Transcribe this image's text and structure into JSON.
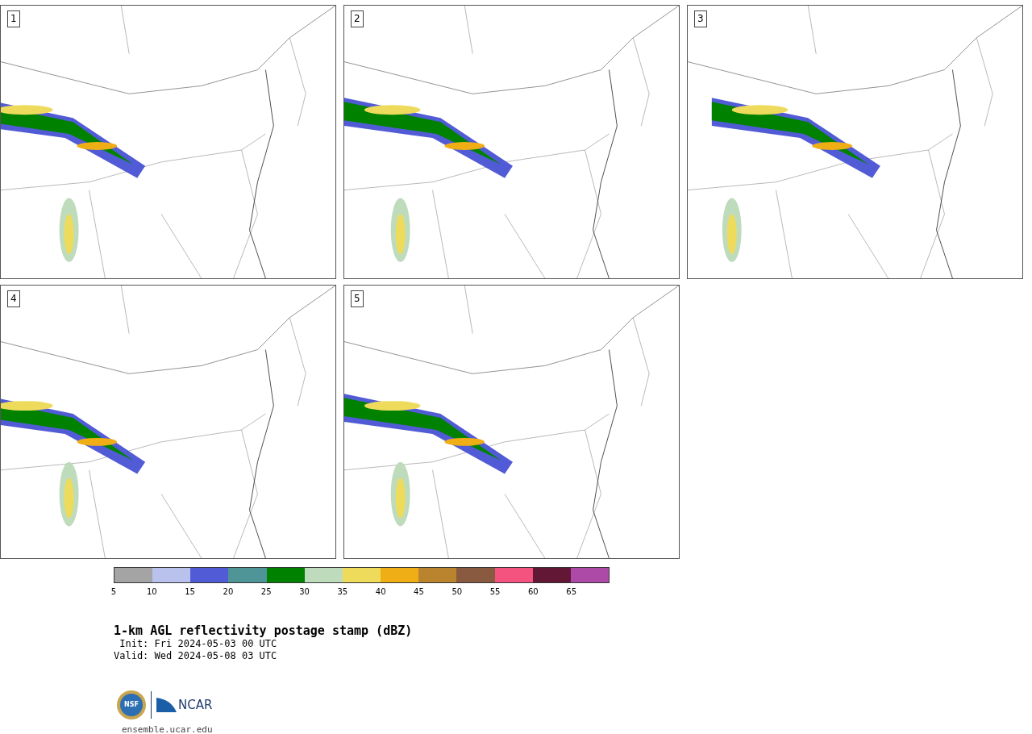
{
  "panels": [
    {
      "label": "1"
    },
    {
      "label": "2"
    },
    {
      "label": "3"
    },
    {
      "label": "4"
    },
    {
      "label": "5"
    }
  ],
  "colorbar": {
    "bins": [
      {
        "color": "#a4a4a4"
      },
      {
        "color": "#b8c2ec"
      },
      {
        "color": "#525bd6"
      },
      {
        "color": "#4f9598"
      },
      {
        "color": "#008200"
      },
      {
        "color": "#bedcbc"
      },
      {
        "color": "#eedb5c"
      },
      {
        "color": "#f0ae16"
      },
      {
        "color": "#ba832e"
      },
      {
        "color": "#895a3f"
      },
      {
        "color": "#f4527f"
      },
      {
        "color": "#621735"
      },
      {
        "color": "#ad4aa8"
      }
    ],
    "ticks": [
      "5",
      "10",
      "15",
      "20",
      "25",
      "30",
      "35",
      "40",
      "45",
      "50",
      "55",
      "60",
      "65"
    ]
  },
  "title": "1-km AGL reflectivity postage stamp (dBZ)",
  "init": " Init: Fri 2024-05-03 00 UTC",
  "valid": "Valid: Wed 2024-05-08 03 UTC",
  "logo": {
    "nsf": "NSF",
    "ncar": "NCAR"
  },
  "url": "ensemble.ucar.edu"
}
